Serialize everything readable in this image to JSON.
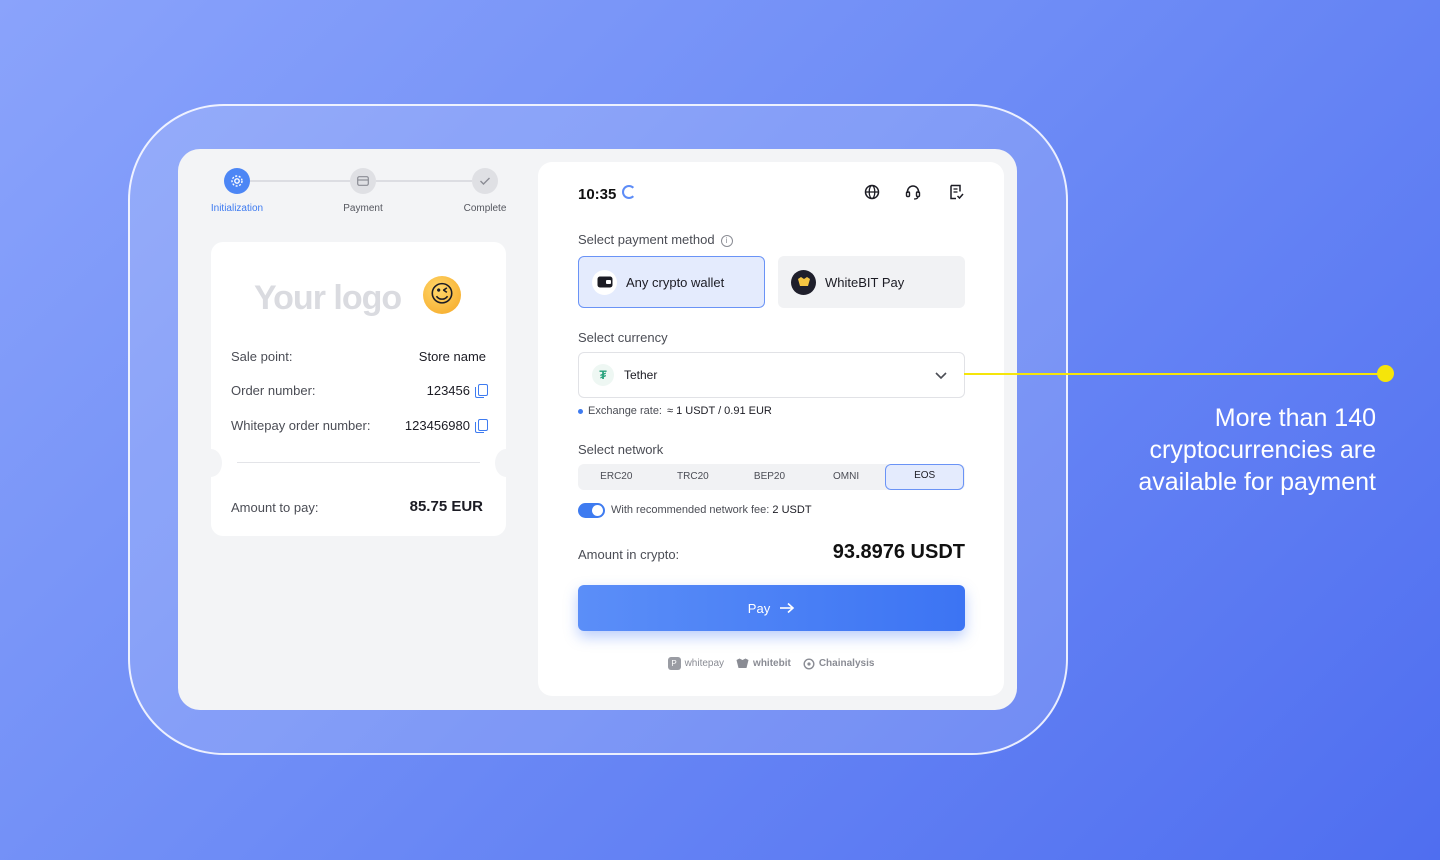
{
  "stepper": {
    "steps": [
      {
        "label": "Initialization",
        "icon": "gear-icon",
        "active": true
      },
      {
        "label": "Payment",
        "icon": "card-icon",
        "active": false
      },
      {
        "label": "Complete",
        "icon": "check-icon",
        "active": false
      }
    ]
  },
  "receipt": {
    "logo_text": "Your logo",
    "logo_emoji": "😉",
    "rows": [
      {
        "label": "Sale point:",
        "value": "Store name"
      },
      {
        "label": "Order number:",
        "value": "123456"
      },
      {
        "label": "Whitepay order number:",
        "value": "123456980"
      }
    ],
    "amount_label": "Amount to pay:",
    "amount_value": "85.75 EUR"
  },
  "header": {
    "time": "10:35",
    "icons": [
      "globe-icon",
      "headset-icon",
      "receipt-check-icon"
    ]
  },
  "payment_method": {
    "label": "Select payment method",
    "options": [
      {
        "label": "Any crypto wallet",
        "icon": "wallet-icon",
        "selected": true
      },
      {
        "label": "WhiteBIT Pay",
        "icon": "whitebit-icon",
        "selected": false
      }
    ]
  },
  "currency": {
    "label": "Select currency",
    "selected": "Tether",
    "icon_glyph": "₮",
    "rate_label": "Exchange rate:",
    "rate_value": "≈ 1 USDT / 0.91 EUR"
  },
  "network": {
    "label": "Select network",
    "options": [
      "ERC20",
      "TRC20",
      "BEP20",
      "OMNI",
      "EOS"
    ],
    "selected": "EOS",
    "fee_label": "With recommended network fee:",
    "fee_value": "2 USDT",
    "fee_enabled": true
  },
  "amount_crypto": {
    "label": "Amount in crypto:",
    "value": "93.8976 USDT"
  },
  "pay_button": {
    "label": "Pay"
  },
  "partners": [
    "whitepay",
    "whitebit",
    "Chainalysis"
  ],
  "annotation": {
    "text": "More than 140 cryptocurrencies are available for payment",
    "color": "#f5e50a"
  },
  "colors": {
    "accent": "#3e7bf0",
    "background_start": "#8aa3fb",
    "background_end": "#4f6ef0"
  }
}
